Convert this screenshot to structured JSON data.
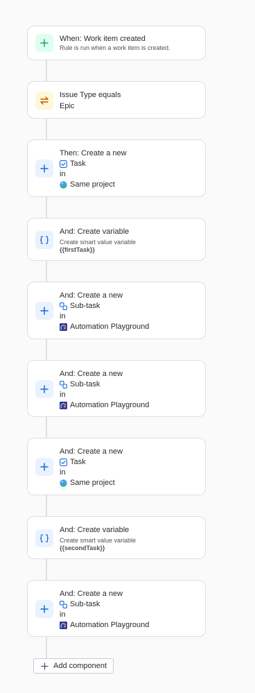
{
  "trigger": {
    "title": "When: Work item created",
    "description": "Rule is run when a work item is created.",
    "icon": "plus-icon"
  },
  "condition": {
    "title": "Issue Type equals",
    "value": "Epic",
    "icon": "swap-icon"
  },
  "steps": [
    {
      "title": "Then: Create a new",
      "issue_type": "Task",
      "in_label": "in",
      "project": "Same project"
    },
    {
      "title": "And: Create variable",
      "description": "Create smart value variable",
      "variable": "{{firstTask}}"
    },
    {
      "title": "And: Create a new",
      "issue_type": "Sub-task",
      "in_label": "in",
      "project": "Automation Playground"
    },
    {
      "title": "And: Create a new",
      "issue_type": "Sub-task",
      "in_label": "in",
      "project": "Automation Playground"
    },
    {
      "title": "And: Create a new",
      "issue_type": "Task",
      "in_label": "in",
      "project": "Same project"
    },
    {
      "title": "And: Create variable",
      "description": "Create smart value variable",
      "variable": "{{secondTask}}"
    },
    {
      "title": "And: Create a new",
      "issue_type": "Sub-task",
      "in_label": "in",
      "project": "Automation Playground"
    }
  ],
  "add_component_label": "Add component",
  "colors": {
    "trigger_green": "#22a06b",
    "condition_orange": "#c25100",
    "action_blue": "#1868db",
    "connector": "#dcdfe4"
  }
}
